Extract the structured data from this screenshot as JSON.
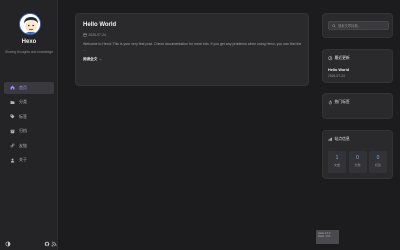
{
  "site": {
    "title": "Hexo",
    "subtitle": "Sharing thoughts and knowledge"
  },
  "nav": {
    "items": [
      {
        "label": "首页",
        "icon": "home-icon",
        "active": true
      },
      {
        "label": "分类",
        "icon": "folder-icon"
      },
      {
        "label": "标签",
        "icon": "tag-icon"
      },
      {
        "label": "归档",
        "icon": "archive-icon"
      },
      {
        "label": "友链",
        "icon": "link-icon"
      },
      {
        "label": "关于",
        "icon": "user-icon"
      }
    ]
  },
  "footer_icons": [
    "theme-toggle-icon",
    "github-icon",
    "rss-icon"
  ],
  "post": {
    "title": "Hello World",
    "date": "2026-07-24",
    "excerpt": "Welcome to Hexo! This is your very first post. Check documentation for more info. If you get any problems when using Hexo, you can find the ...",
    "read_more": "阅读全文 →"
  },
  "search": {
    "placeholder": "搜索文章标题..."
  },
  "recent": {
    "heading": "最近更新",
    "post_title": "Hello World",
    "post_date": "2026-07-24"
  },
  "hot": {
    "heading": "热门标签"
  },
  "stats": {
    "heading": "站点信息",
    "items": [
      {
        "value": "1",
        "label": "文章"
      },
      {
        "value": "0",
        "label": "分类"
      },
      {
        "value": "0",
        "label": "标签"
      }
    ]
  },
  "build_tag": {
    "line1": "Hello 2.0.0",
    "line2": "Build: 7/24"
  },
  "colors": {
    "background": "#1c1c1e",
    "card": "#2a2a2d",
    "accent": "#a78bfa",
    "stat_number": "#7aa7ff"
  }
}
